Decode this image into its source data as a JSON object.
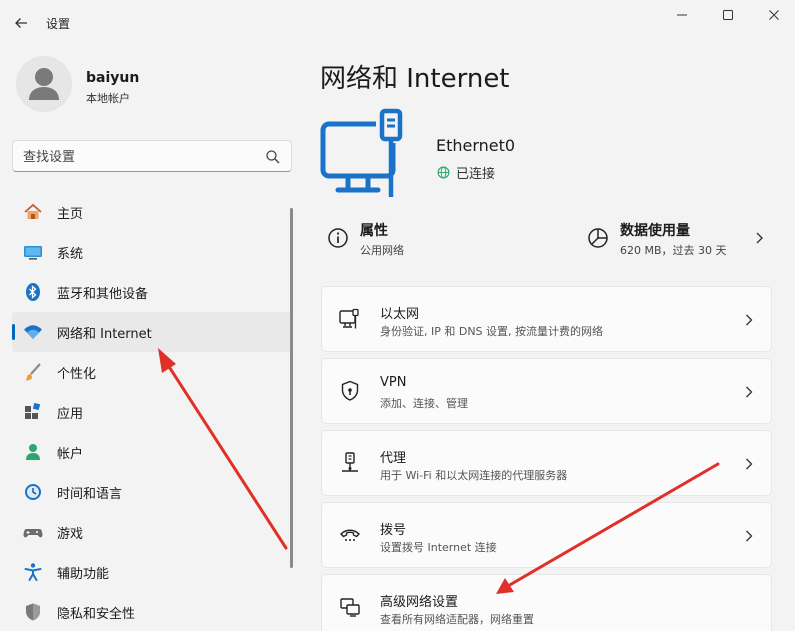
{
  "app": {
    "title": "设置"
  },
  "user": {
    "name": "baiyun",
    "account_type": "本地帐户"
  },
  "search": {
    "placeholder": "查找设置"
  },
  "sidebar": {
    "items": [
      {
        "label": "主页",
        "icon": "home-icon"
      },
      {
        "label": "系统",
        "icon": "system-icon"
      },
      {
        "label": "蓝牙和其他设备",
        "icon": "bluetooth-icon"
      },
      {
        "label": "网络和 Internet",
        "icon": "wifi-icon",
        "active": true
      },
      {
        "label": "个性化",
        "icon": "brush-icon"
      },
      {
        "label": "应用",
        "icon": "apps-icon"
      },
      {
        "label": "帐户",
        "icon": "account-icon"
      },
      {
        "label": "时间和语言",
        "icon": "clock-icon"
      },
      {
        "label": "游戏",
        "icon": "gamepad-icon"
      },
      {
        "label": "辅助功能",
        "icon": "accessibility-icon"
      },
      {
        "label": "隐私和安全性",
        "icon": "shield-icon"
      }
    ]
  },
  "main": {
    "title": "网络和 Internet",
    "adapter": {
      "name": "Ethernet0",
      "status": "已连接"
    },
    "properties": {
      "title": "属性",
      "subtitle": "公用网络"
    },
    "data_usage": {
      "title": "数据使用量",
      "subtitle": "620 MB，过去 30 天"
    },
    "cards": [
      {
        "title": "以太网",
        "subtitle": "身份验证, IP 和 DNS 设置, 按流量计费的网络",
        "icon": "ethernet-monitor-icon"
      },
      {
        "title": "VPN",
        "subtitle": "添加、连接、管理",
        "icon": "vpn-shield-icon"
      },
      {
        "title": "代理",
        "subtitle": "用于 Wi-Fi 和以太网连接的代理服务器",
        "icon": "proxy-icon"
      },
      {
        "title": "拨号",
        "subtitle": "设置拨号 Internet 连接",
        "icon": "dialup-icon"
      },
      {
        "title": "高级网络设置",
        "subtitle": "查看所有网络适配器，网络重置",
        "icon": "advanced-network-icon"
      }
    ]
  },
  "colors": {
    "accent": "#0067c0",
    "annotation_arrow": "#e0302a",
    "ethernet_icon": "#1a73c8"
  }
}
